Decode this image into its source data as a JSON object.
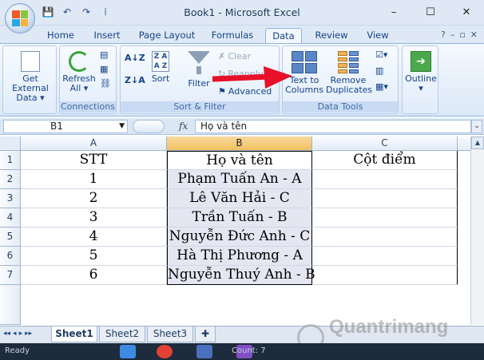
{
  "window": {
    "title": "Book1 - Microsoft Excel",
    "minimize": "–",
    "maximize": "☐",
    "close": "✕"
  },
  "qat": {
    "save": "💾",
    "undo": "↶",
    "redo": "↷",
    "customize": "⁞"
  },
  "tabs": [
    "Home",
    "Insert",
    "Page Layout",
    "Formulas",
    "Data",
    "Review",
    "View"
  ],
  "active_tab": "Data",
  "ribbon": {
    "get_external": [
      "Get External",
      "Data ▾"
    ],
    "refresh": [
      "Refresh",
      "All ▾"
    ],
    "connections_label": "Connections",
    "sort_label": "Sort",
    "filter_label": "Filter",
    "clear_label": "Clear",
    "reapply_label": "Reapply",
    "advanced_label": "Advanced",
    "sort_filter_group": "Sort & Filter",
    "text_to_columns": [
      "Text to",
      "Columns"
    ],
    "remove_duplicates": [
      "Remove",
      "Duplicates"
    ],
    "data_tools_group": "Data Tools",
    "outline": [
      "Outline",
      "▾"
    ]
  },
  "formula_bar": {
    "name_box": "B1",
    "fx": "fx",
    "content": "Họ và tên"
  },
  "columns": [
    "A",
    "B",
    "C"
  ],
  "rows": [
    "1",
    "2",
    "3",
    "4",
    "5",
    "6",
    "7"
  ],
  "table": [
    [
      "STT",
      "Họ và tên",
      "Cột điểm"
    ],
    [
      "1",
      "Phạm Tuấn An - A",
      ""
    ],
    [
      "2",
      "Lê Văn Hải - C",
      ""
    ],
    [
      "3",
      "Trần Tuấn - B",
      ""
    ],
    [
      "4",
      "Nguyễn Đức Anh - C",
      ""
    ],
    [
      "5",
      "Hà Thị Phương - A",
      ""
    ],
    [
      "6",
      "Nguyễn Thuý Anh - B",
      ""
    ]
  ],
  "sheets": [
    "Sheet1",
    "Sheet2",
    "Sheet3"
  ],
  "active_sheet": "Sheet1",
  "sheet_nav": [
    "◂◂",
    "◂",
    "▸",
    "▸▸"
  ],
  "status": {
    "ready": "Ready",
    "count": "Count: 7"
  },
  "watermark": "Quantrimang",
  "colors": {
    "ribbon_blue": "#15428b",
    "selected_col": "#f1c15f",
    "arrow_red": "#e8102a"
  }
}
